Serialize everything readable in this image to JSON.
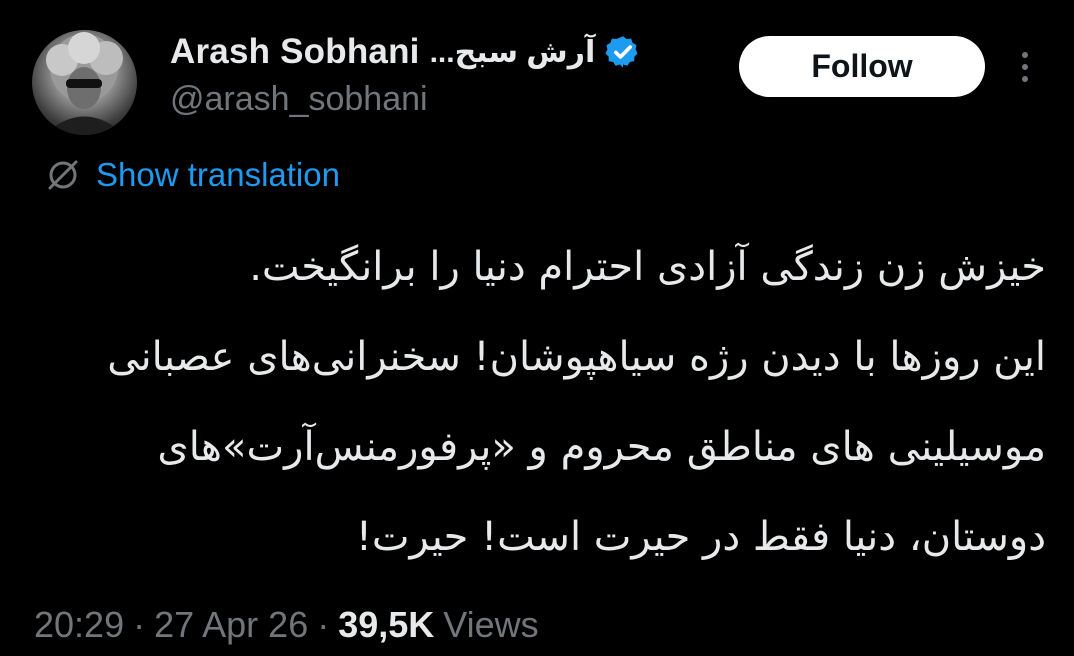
{
  "author": {
    "display_name": "Arash Sobhani",
    "display_name_fa": "آرش سبح...",
    "handle": "@arash_sobhani",
    "verified_icon": "verified-badge-icon",
    "avatar_icon": "avatar"
  },
  "actions": {
    "follow_label": "Follow",
    "more_icon": "more-options-icon"
  },
  "translation": {
    "label": "Show translation",
    "icon": "translate-icon"
  },
  "tweet": {
    "lines": [
      "خیزش زن زندگی آزادی احترام دنیا را برانگیخت.",
      "این روزها با دیدن رژه سیاهپوشان! سخنرانی‌های عصبانی",
      "موسیلینی های مناطق محروم و  «پرفورمنس‌آرت»‌های",
      "دوستان، دنیا فقط در حیرت است! حیرت!"
    ]
  },
  "meta": {
    "time": "20:29",
    "separator": "·",
    "date": "27 Apr 26",
    "views_count": "39,5K",
    "views_label": "Views"
  },
  "colors": {
    "background": "#000000",
    "text_primary": "#e7e9ea",
    "text_secondary": "#71767b",
    "accent": "#1d9bf0",
    "button_bg": "#ffffff"
  }
}
